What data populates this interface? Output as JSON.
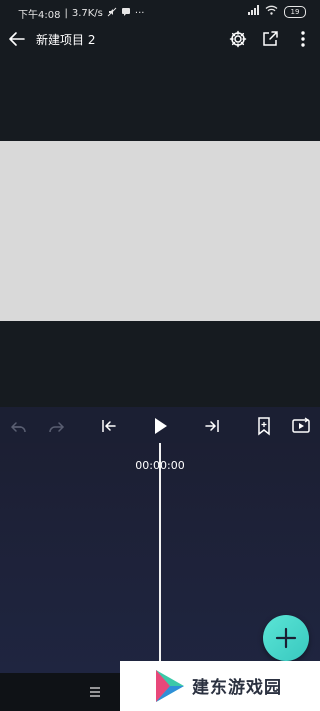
{
  "status_bar": {
    "time": "下午4:08",
    "net_speed": "3.7K/s",
    "battery": "19"
  },
  "toolbar": {
    "title": "新建项目 2"
  },
  "timeline": {
    "timecode": "00:00:00"
  },
  "watermark": {
    "text": "建东游戏园"
  },
  "colors": {
    "background": "#161b20",
    "canvas": "#d9d9d9",
    "timeline": "#1f2540",
    "accent": "#4cd9cc"
  }
}
